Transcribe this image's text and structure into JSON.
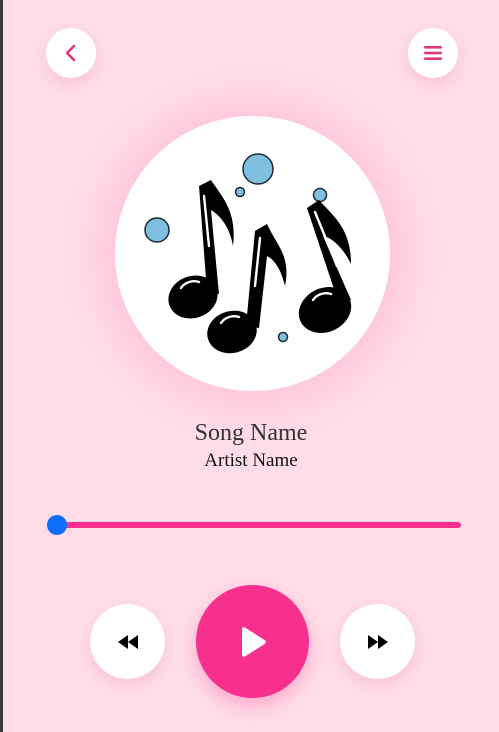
{
  "header": {
    "back_icon": "chevron-left-icon",
    "menu_icon": "hamburger-menu-icon"
  },
  "artwork": {
    "icon": "music-notes-icon"
  },
  "track": {
    "title": "Song Name",
    "artist": "Artist Name"
  },
  "progress": {
    "fraction": 0.0
  },
  "controls": {
    "prev_icon": "rewind-icon",
    "play_icon": "play-icon",
    "next_icon": "fast-forward-icon"
  },
  "colors": {
    "background": "#ffdde8",
    "accent": "#f72f8d",
    "progress_thumb": "#0d6efd"
  }
}
